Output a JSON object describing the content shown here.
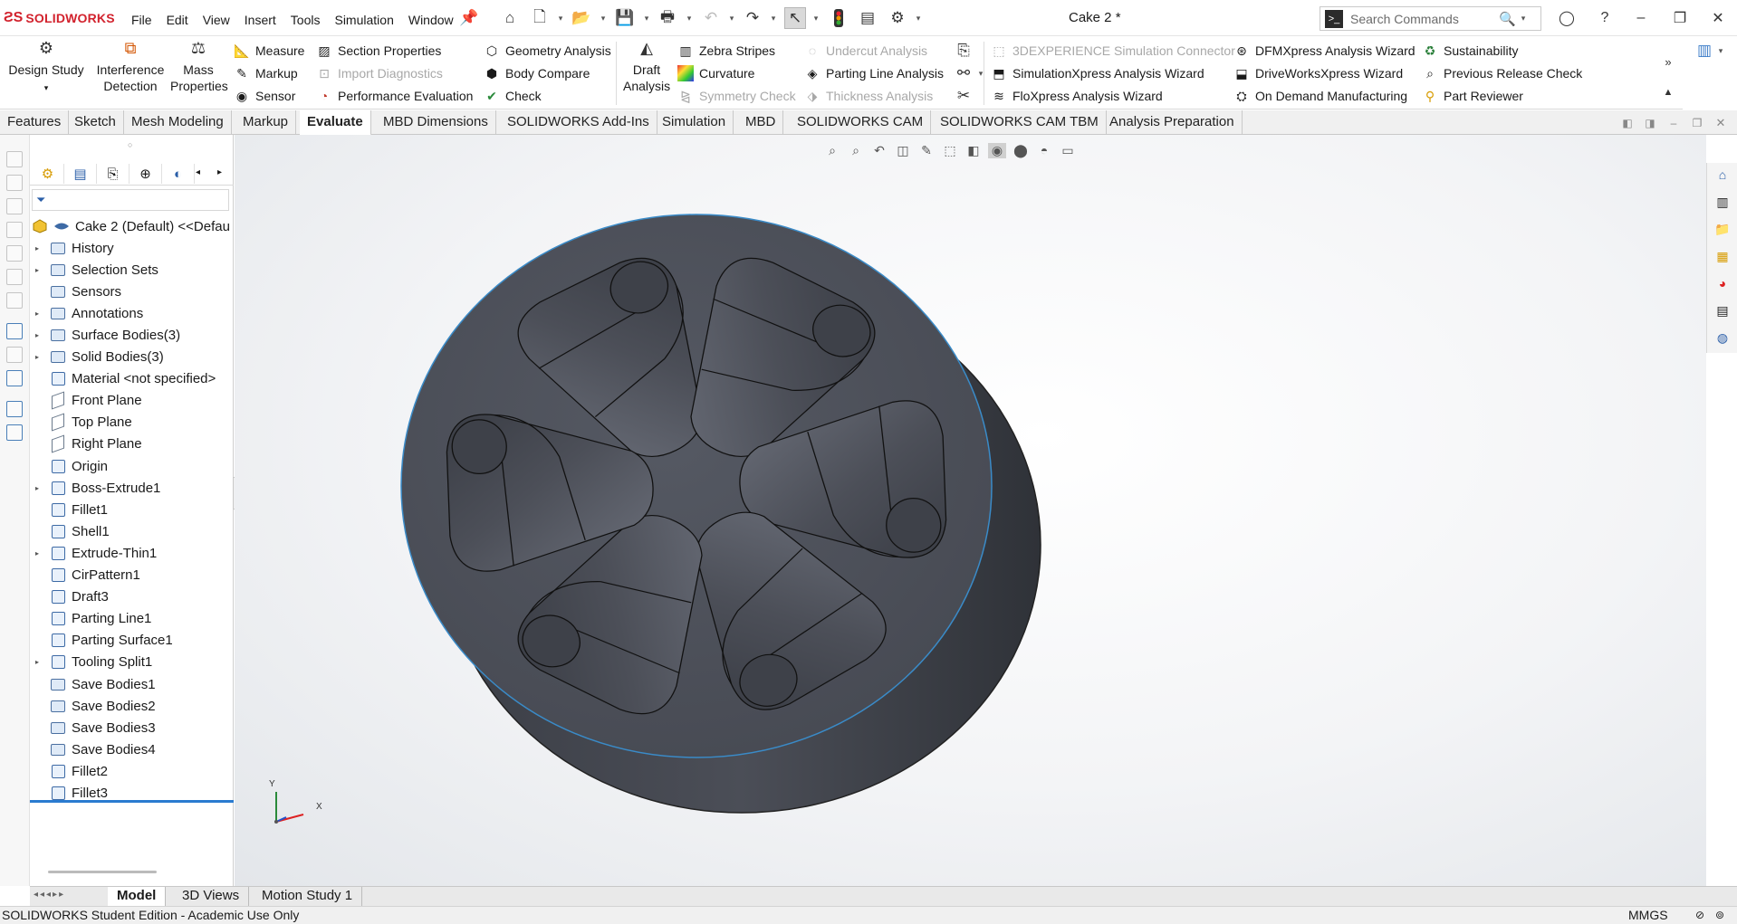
{
  "app": {
    "name": "SOLIDWORKS",
    "doc_title": "Cake 2 *"
  },
  "menu": [
    "File",
    "Edit",
    "View",
    "Insert",
    "Tools",
    "Simulation",
    "Window"
  ],
  "search": {
    "placeholder": "Search Commands"
  },
  "ribbon": {
    "design_study": "Design Study",
    "interference_1": "Interference",
    "interference_2": "Detection",
    "mass_1": "Mass",
    "mass_2": "Properties",
    "measure": "Measure",
    "markup": "Markup",
    "sensor": "Sensor",
    "section_properties": "Section Properties",
    "import_diagnostics": "Import Diagnostics",
    "performance_evaluation": "Performance Evaluation",
    "geometry_analysis": "Geometry Analysis",
    "body_compare": "Body Compare",
    "check": "Check",
    "draft_1": "Draft",
    "draft_2": "Analysis",
    "zebra": "Zebra Stripes",
    "curvature": "Curvature",
    "symmetry": "Symmetry Check",
    "undercut": "Undercut Analysis",
    "parting_line": "Parting Line Analysis",
    "thickness": "Thickness Analysis",
    "experience_connector": "3DEXPERIENCE Simulation Connector",
    "simulationxpress": "SimulationXpress Analysis Wizard",
    "floxpress": "FloXpress Analysis Wizard",
    "dfmxpress": "DFMXpress Analysis Wizard",
    "driveworks": "DriveWorksXpress Wizard",
    "on_demand": "On Demand Manufacturing",
    "sustainability": "Sustainability",
    "previous_release": "Previous Release Check",
    "part_reviewer": "Part Reviewer"
  },
  "tabs": [
    "Features",
    "Sketch",
    "Mesh Modeling",
    "Markup",
    "Evaluate",
    "MBD Dimensions",
    "SOLIDWORKS Add-Ins",
    "Simulation",
    "MBD",
    "SOLIDWORKS CAM",
    "SOLIDWORKS CAM TBM",
    "Analysis Preparation"
  ],
  "active_tab": "Evaluate",
  "tree": {
    "root": "Cake 2 (Default) <<Defau",
    "items": [
      {
        "label": "History",
        "icon": "history-icon"
      },
      {
        "label": "Selection Sets",
        "icon": "selection-sets-icon"
      },
      {
        "label": "Sensors",
        "icon": "sensors-icon"
      },
      {
        "label": "Annotations",
        "icon": "annotations-icon"
      },
      {
        "label": "Surface Bodies(3)",
        "icon": "surface-bodies-icon"
      },
      {
        "label": "Solid Bodies(3)",
        "icon": "solid-bodies-icon"
      },
      {
        "label": "Material <not specified>",
        "icon": "material-icon"
      },
      {
        "label": "Front Plane",
        "icon": "plane-icon"
      },
      {
        "label": "Top Plane",
        "icon": "plane-icon"
      },
      {
        "label": "Right Plane",
        "icon": "plane-icon"
      },
      {
        "label": "Origin",
        "icon": "origin-icon"
      },
      {
        "label": "Boss-Extrude1",
        "icon": "extrude-icon"
      },
      {
        "label": "Fillet1",
        "icon": "fillet-icon"
      },
      {
        "label": "Shell1",
        "icon": "shell-icon"
      },
      {
        "label": "Extrude-Thin1",
        "icon": "extrude-icon"
      },
      {
        "label": "CirPattern1",
        "icon": "circular-pattern-icon"
      },
      {
        "label": "Draft3",
        "icon": "draft-icon"
      },
      {
        "label": "Parting Line1",
        "icon": "parting-line-icon"
      },
      {
        "label": "Parting Surface1",
        "icon": "parting-surface-icon"
      },
      {
        "label": "Tooling Split1",
        "icon": "tooling-split-icon"
      },
      {
        "label": "Save Bodies1",
        "icon": "save-bodies-icon"
      },
      {
        "label": "Save Bodies2",
        "icon": "save-bodies-icon"
      },
      {
        "label": "Save Bodies3",
        "icon": "save-bodies-icon"
      },
      {
        "label": "Save Bodies4",
        "icon": "save-bodies-icon"
      },
      {
        "label": "Fillet2",
        "icon": "fillet-icon"
      },
      {
        "label": "Fillet3",
        "icon": "fillet-icon"
      }
    ]
  },
  "bottom_tabs": [
    "Model",
    "3D Views",
    "Motion Study 1"
  ],
  "status": {
    "left": "SOLIDWORKS Student Edition - Academic Use Only",
    "units": "MMGS"
  },
  "triad": {
    "x": "X",
    "y": "Y"
  },
  "colors": {
    "part": "#4a4d55",
    "accent": "#d2222d",
    "edge_highlight": "#3a8bc8"
  }
}
